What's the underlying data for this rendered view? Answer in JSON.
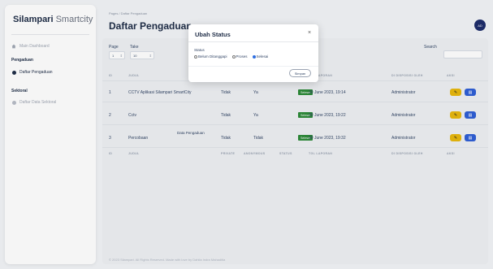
{
  "sidebar": {
    "brand_bold": "Silampari",
    "brand_light": "Smartcity",
    "items": [
      {
        "label": "Main Dashboard",
        "icon": "home-icon"
      },
      {
        "label": "Pengaduan"
      },
      {
        "label": "Daftar Pengaduan",
        "icon": "info-icon"
      },
      {
        "label": "Sektoral"
      },
      {
        "label": "Daftar Data Sektoral",
        "icon": "gear-icon"
      }
    ]
  },
  "header": {
    "breadcrumb": "Pages / Daftar Pengaduan",
    "title": "Daftar Pengaduan",
    "avatar": "AD"
  },
  "controls": {
    "page_label": "Page",
    "page_value": "1",
    "take_label": "Take",
    "take_value": "10",
    "search_label": "Search"
  },
  "table": {
    "headers": [
      "ID",
      "JUDUL",
      "PRIVATE",
      "ANONYMOUS",
      "STATUS",
      "TGL LAPORAN",
      "DI DISPOSISI OLEH",
      "AKSI"
    ],
    "rows": [
      {
        "id": "1",
        "judul": "CCTV Aplikasi Silampari SmartCity",
        "private": "Tidak",
        "anonymous": "Ya",
        "status": "Selesai",
        "tgl": "30 June 2023, 19:14",
        "oleh": "Administrator"
      },
      {
        "id": "2",
        "judul": "Cctv",
        "private": "Tidak",
        "anonymous": "Ya",
        "status": "Selesai",
        "tgl": "30 June 2023, 19:22",
        "oleh": "Administrator"
      },
      {
        "id": "3",
        "judul": "Percobaan",
        "private": "Tidak",
        "anonymous": "Tidak",
        "status": "Selesai",
        "tgl": "30 June 2023, 19:32",
        "oleh": "Administrator"
      }
    ],
    "summary": "Data Pengaduan"
  },
  "footer": "© 2023 Silampari. All Rights Reserved. Made with love by Dahlia Indra Mahaditia",
  "modal": {
    "title": "Ubah Status",
    "close": "×",
    "status_label": "Status",
    "options": [
      "Belum Ditanggapi",
      "Proses",
      "Selesai"
    ],
    "selected": "Selesai",
    "save_label": "Simpan"
  },
  "colors": {
    "success": "#2e8b3a",
    "edit": "#e8b80e",
    "view": "#2f5fd6",
    "avatar": "#1e2d6b"
  }
}
